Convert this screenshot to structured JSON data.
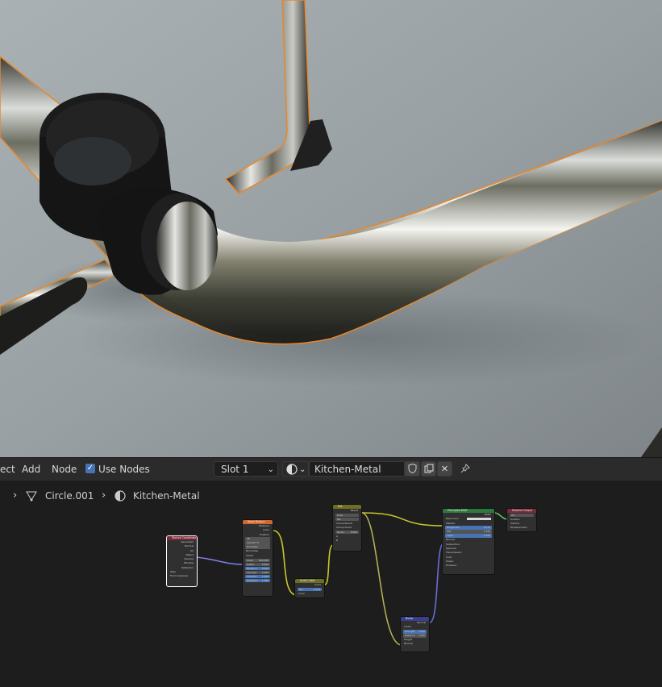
{
  "toolbar": {
    "menu_object": "ect",
    "menu_add": "Add",
    "menu_node": "Node",
    "use_nodes_label": "Use Nodes",
    "use_nodes_checked": true,
    "slot": "Slot 1",
    "material_name": "Kitchen-Metal"
  },
  "breadcrumb": {
    "object": "Circle.001",
    "material": "Kitchen-Metal"
  },
  "nodes": {
    "texcoord": {
      "title": "Texture Coordinate",
      "outputs": [
        "Generated",
        "Normal",
        "UV",
        "Object",
        "Camera",
        "Window",
        "Reflection"
      ],
      "object_label": "Obje",
      "from_instancer": "From Instancer"
    },
    "noise": {
      "title": "Noise Texture",
      "outputs": [
        "Distance",
        "Color",
        "Position"
      ],
      "dims": "3D",
      "type": "Smooth F1",
      "metric": "Euclidean",
      "normalize": "Normalize",
      "vector": "Vector",
      "scale": {
        "label": "Scale",
        "value": "600.000"
      },
      "detail": {
        "label": "Detail",
        "value": "0.000"
      },
      "roughness": {
        "label": "Roughne",
        "value": "0.500"
      },
      "lacunarity": {
        "label": "Lacunari",
        "value": "2.000"
      },
      "smoothness": {
        "label": "Smoothn",
        "value": "1.000"
      },
      "randomness": {
        "label": "Randomn",
        "value": "1.000"
      }
    },
    "invert": {
      "title": "Invert Color",
      "out": "Color",
      "fac_label": "Fac",
      "fac_value": "0.139",
      "color_in": "Color"
    },
    "mix": {
      "title": "Mix",
      "out": "Result",
      "type": "Color",
      "blend": "Mix",
      "clamp_result": "Clamp Result",
      "clamp_factor": "Clamp Factor",
      "factor_label": "Factor",
      "factor_value": "0.000",
      "a": "A",
      "b": "B"
    },
    "bump": {
      "title": "Bump",
      "out": "Normal",
      "invert": "Invert",
      "strength_label": "Strength",
      "strength_value": "1.000",
      "distance_label": "Distance",
      "distance_value": "1.000",
      "height": "Height",
      "normal": "Normal"
    },
    "bsdf": {
      "title": "Principled BSDF",
      "out": "BSDF",
      "base_color": "Base Color",
      "metallic": "Metallic",
      "roughness_label": "Roughness",
      "roughness_value": "0.114",
      "ior_label": "IOR",
      "ior_value": "1.450",
      "alpha_label": "Alpha",
      "alpha_value": "1.000",
      "normal": "Normal",
      "subsurface": "Subsurface",
      "specular": "Specular",
      "transmission": "Transmission",
      "coat": "Coat",
      "sheen": "Sheen",
      "emission": "Emission"
    },
    "output": {
      "title": "Material Output",
      "target": "All",
      "surface": "Surface",
      "volume": "Volume",
      "displacement": "Displacement"
    }
  },
  "colors": {
    "selection_outline": "#e8872a",
    "checkbox": "#4772b3",
    "socket_yellow": "#c7c729",
    "socket_gray": "#a1a1a1",
    "socket_purple": "#6363c7",
    "socket_green": "#63c763",
    "header_texture": "#d0672e",
    "header_converter": "#3f7d8a",
    "header_color": "#6e6d24",
    "header_vector": "#3b3e8c",
    "header_shader": "#2e7a3e",
    "header_output": "#7a2a38"
  },
  "icons": [
    "checkbox-icon",
    "chevron-down-icon",
    "material-sphere-icon",
    "shield-icon",
    "duplicate-icon",
    "close-icon",
    "pin-icon",
    "chevron-right-icon",
    "mesh-vertex-icon"
  ]
}
